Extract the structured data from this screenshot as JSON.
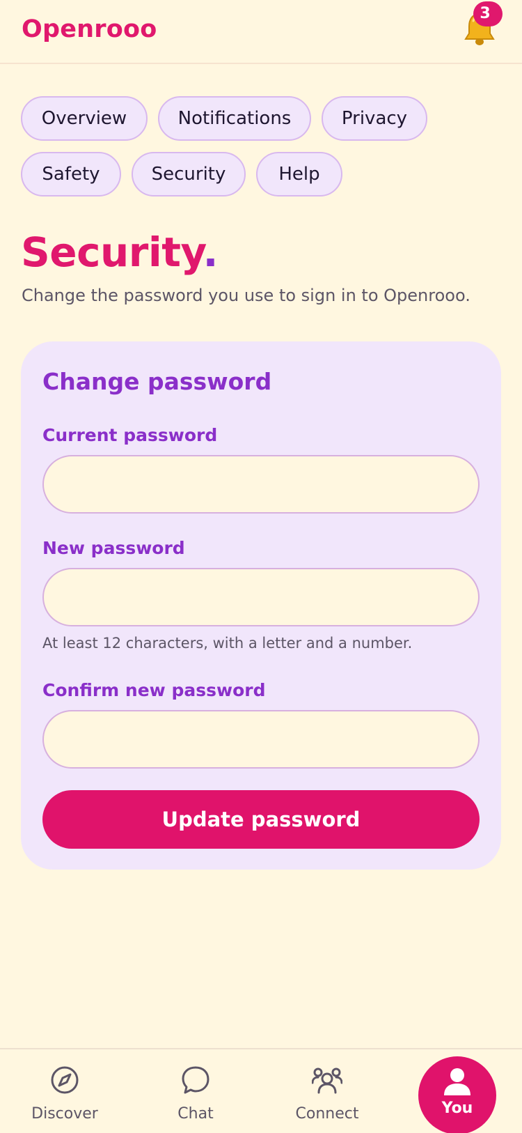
{
  "app": {
    "brand": "Openrooo",
    "notifications_count": "3"
  },
  "tabs": [
    {
      "label": "Overview"
    },
    {
      "label": "Notifications"
    },
    {
      "label": "Privacy"
    },
    {
      "label": "Safety"
    },
    {
      "label": "Security"
    },
    {
      "label": "Help"
    }
  ],
  "page": {
    "title": "Security",
    "title_dot": ".",
    "subtitle": "Change the password you use to sign in to Openrooo."
  },
  "form": {
    "heading": "Change password",
    "current_label": "Current password",
    "current_value": "",
    "new_label": "New password",
    "new_value": "",
    "new_hint": "At least 12 characters, with a letter and a number.",
    "confirm_label": "Confirm new password",
    "confirm_value": "",
    "submit_label": "Update password"
  },
  "nav": [
    {
      "label": "Discover",
      "icon": "compass-icon"
    },
    {
      "label": "Chat",
      "icon": "chat-bubble-icon"
    },
    {
      "label": "Connect",
      "icon": "people-icon"
    },
    {
      "label": "You",
      "icon": "user-icon",
      "active": true
    }
  ],
  "colors": {
    "background": "#FFF7E0",
    "accent_pink": "#E0186D",
    "accent_purple": "#8A2FC9",
    "card": "#F1E6FB"
  }
}
